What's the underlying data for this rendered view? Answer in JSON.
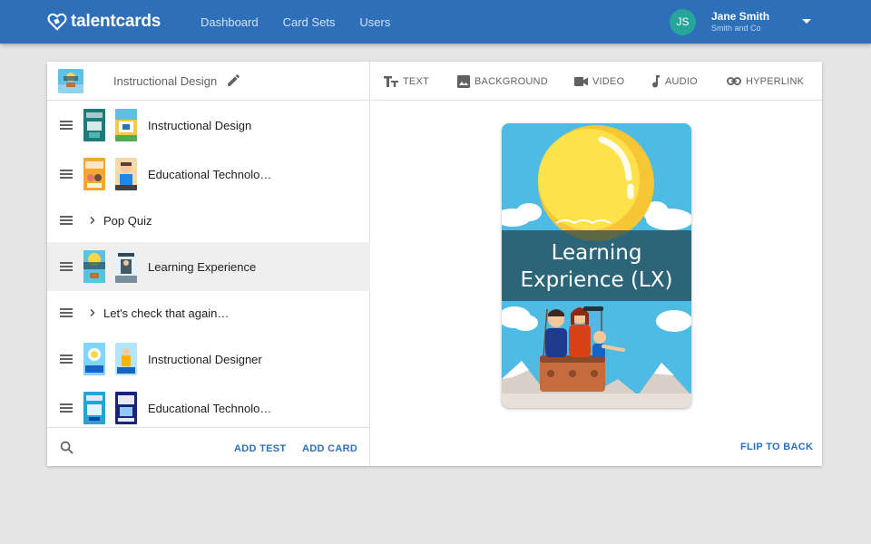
{
  "app": {
    "logo_text": "talentcards"
  },
  "nav": {
    "items": [
      "Dashboard",
      "Card Sets",
      "Users"
    ]
  },
  "user": {
    "initials": "JS",
    "name": "Jane Smith",
    "org": "Smith and Co"
  },
  "set": {
    "title": "Instructional Design"
  },
  "cards_list": [
    {
      "label": "Instructional Design",
      "kind": "card"
    },
    {
      "label": "Educational Technolo…",
      "kind": "card"
    },
    {
      "label": "Pop Quiz",
      "kind": "test"
    },
    {
      "label": "Learning Experience",
      "kind": "card",
      "selected": true
    },
    {
      "label": "Let's check that again…",
      "kind": "test"
    },
    {
      "label": "Instructional Designer",
      "kind": "card"
    },
    {
      "label": "Educational Technolo…",
      "kind": "card"
    }
  ],
  "footer": {
    "add_test": "ADD TEST",
    "add_card": "ADD CARD"
  },
  "toolbar": {
    "text": "TEXT",
    "background": "BACKGROUND",
    "video": "VIDEO",
    "audio": "AUDIO",
    "hyperlink": "HYPERLINK"
  },
  "preview": {
    "title_line1": "Learning",
    "title_line2": "Exprience (LX)",
    "flip_label": "FLIP TO BACK"
  },
  "colors": {
    "brand": "#2d6fb9",
    "avatar": "#26a69a",
    "selected_row": "#efefef"
  }
}
